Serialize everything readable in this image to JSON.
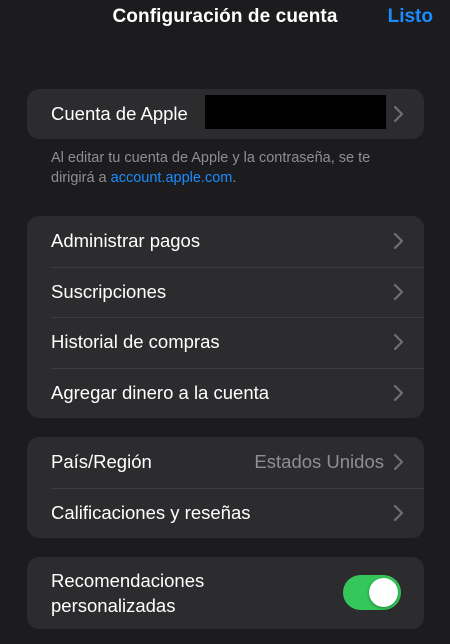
{
  "nav": {
    "title": "Configuración de cuenta",
    "done_label": "Listo",
    "accent_color": "#1a8cff"
  },
  "account_group": {
    "apple_account_label": "Cuenta de Apple"
  },
  "footnote": {
    "text_before_link": "Al editar tu cuenta de Apple y la contraseña, se te dirigirá a ",
    "link_text": "account.apple.com",
    "text_after_link": "."
  },
  "payments_group": {
    "items": [
      {
        "label": "Administrar pagos"
      },
      {
        "label": "Suscripciones"
      },
      {
        "label": "Historial de compras"
      },
      {
        "label": "Agregar dinero a la cuenta"
      }
    ]
  },
  "region_group": {
    "country_label": "País/Región",
    "country_value": "Estados Unidos",
    "ratings_label": "Calificaciones y reseñas"
  },
  "recommendations_group": {
    "label": "Recomendaciones personalizadas",
    "toggle_on": true,
    "toggle_color": "#34c759"
  }
}
